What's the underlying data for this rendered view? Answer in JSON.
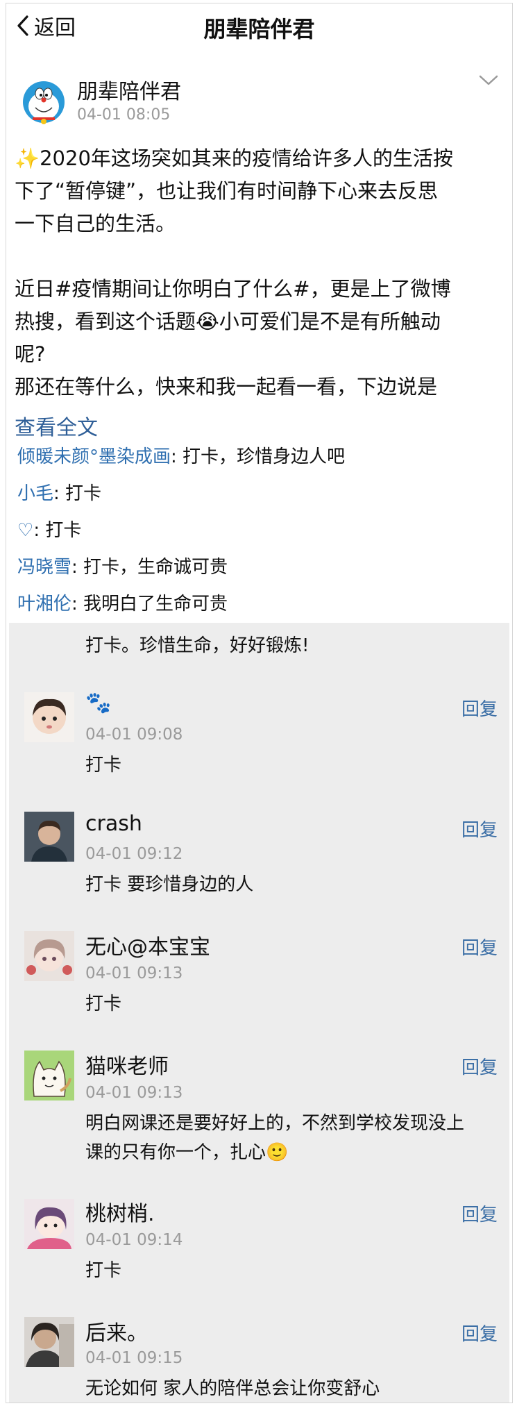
{
  "nav": {
    "back_label": "返回",
    "title": "朋辈陪伴君"
  },
  "post": {
    "author": "朋辈陪伴君",
    "time": "04-01 08:05",
    "lines": [
      "✨2020年这场突如其来的疫情给许多人的生活按",
      "下了“暂停键”，也让我们有时间静下心来去反思",
      "一下自己的生活。",
      "近日#疫情期间让你明白了什么#，更是上了微博",
      "热搜，看到这个话题😭小可爱们是不是有所触动",
      "呢?",
      "那还在等什么，快来和我一起看一看，下边说是"
    ],
    "read_more": "查看全文"
  },
  "quick_comments": [
    {
      "name": "倾暖未颜°墨染成画",
      "text": ": 打卡，珍惜身边人吧"
    },
    {
      "name": "小毛",
      "text": ": 打卡"
    },
    {
      "name": "♡",
      "text": ": 打卡"
    },
    {
      "name": "冯晓雪",
      "text": ": 打卡，生命诚可贵"
    },
    {
      "name": "叶湘伦",
      "text": ": 我明白了生命可贵"
    }
  ],
  "comments": {
    "partial_text": "打卡。珍惜生命，好好锻炼!",
    "reply_label": "回复",
    "items": [
      {
        "name": "🐾",
        "time": "04-01 09:08",
        "text": "打卡"
      },
      {
        "name": "crash",
        "time": "04-01 09:12",
        "text": "打卡  要珍惜身边的人"
      },
      {
        "name": "无心@本宝宝",
        "time": "04-01 09:13",
        "text": "打卡"
      },
      {
        "name": "猫咪老师",
        "time": "04-01 09:13",
        "text_line1": "明白网课还是要好好上的，不然到学校发现没上",
        "text_line2": "课的只有你一个，扎心🙂"
      },
      {
        "name": "桃树梢.",
        "time": "04-01 09:14",
        "text": "打卡"
      },
      {
        "name": "后来。",
        "time": "04-01 09:15",
        "text": "无论如何  家人的陪伴总会让你变舒心"
      }
    ]
  }
}
